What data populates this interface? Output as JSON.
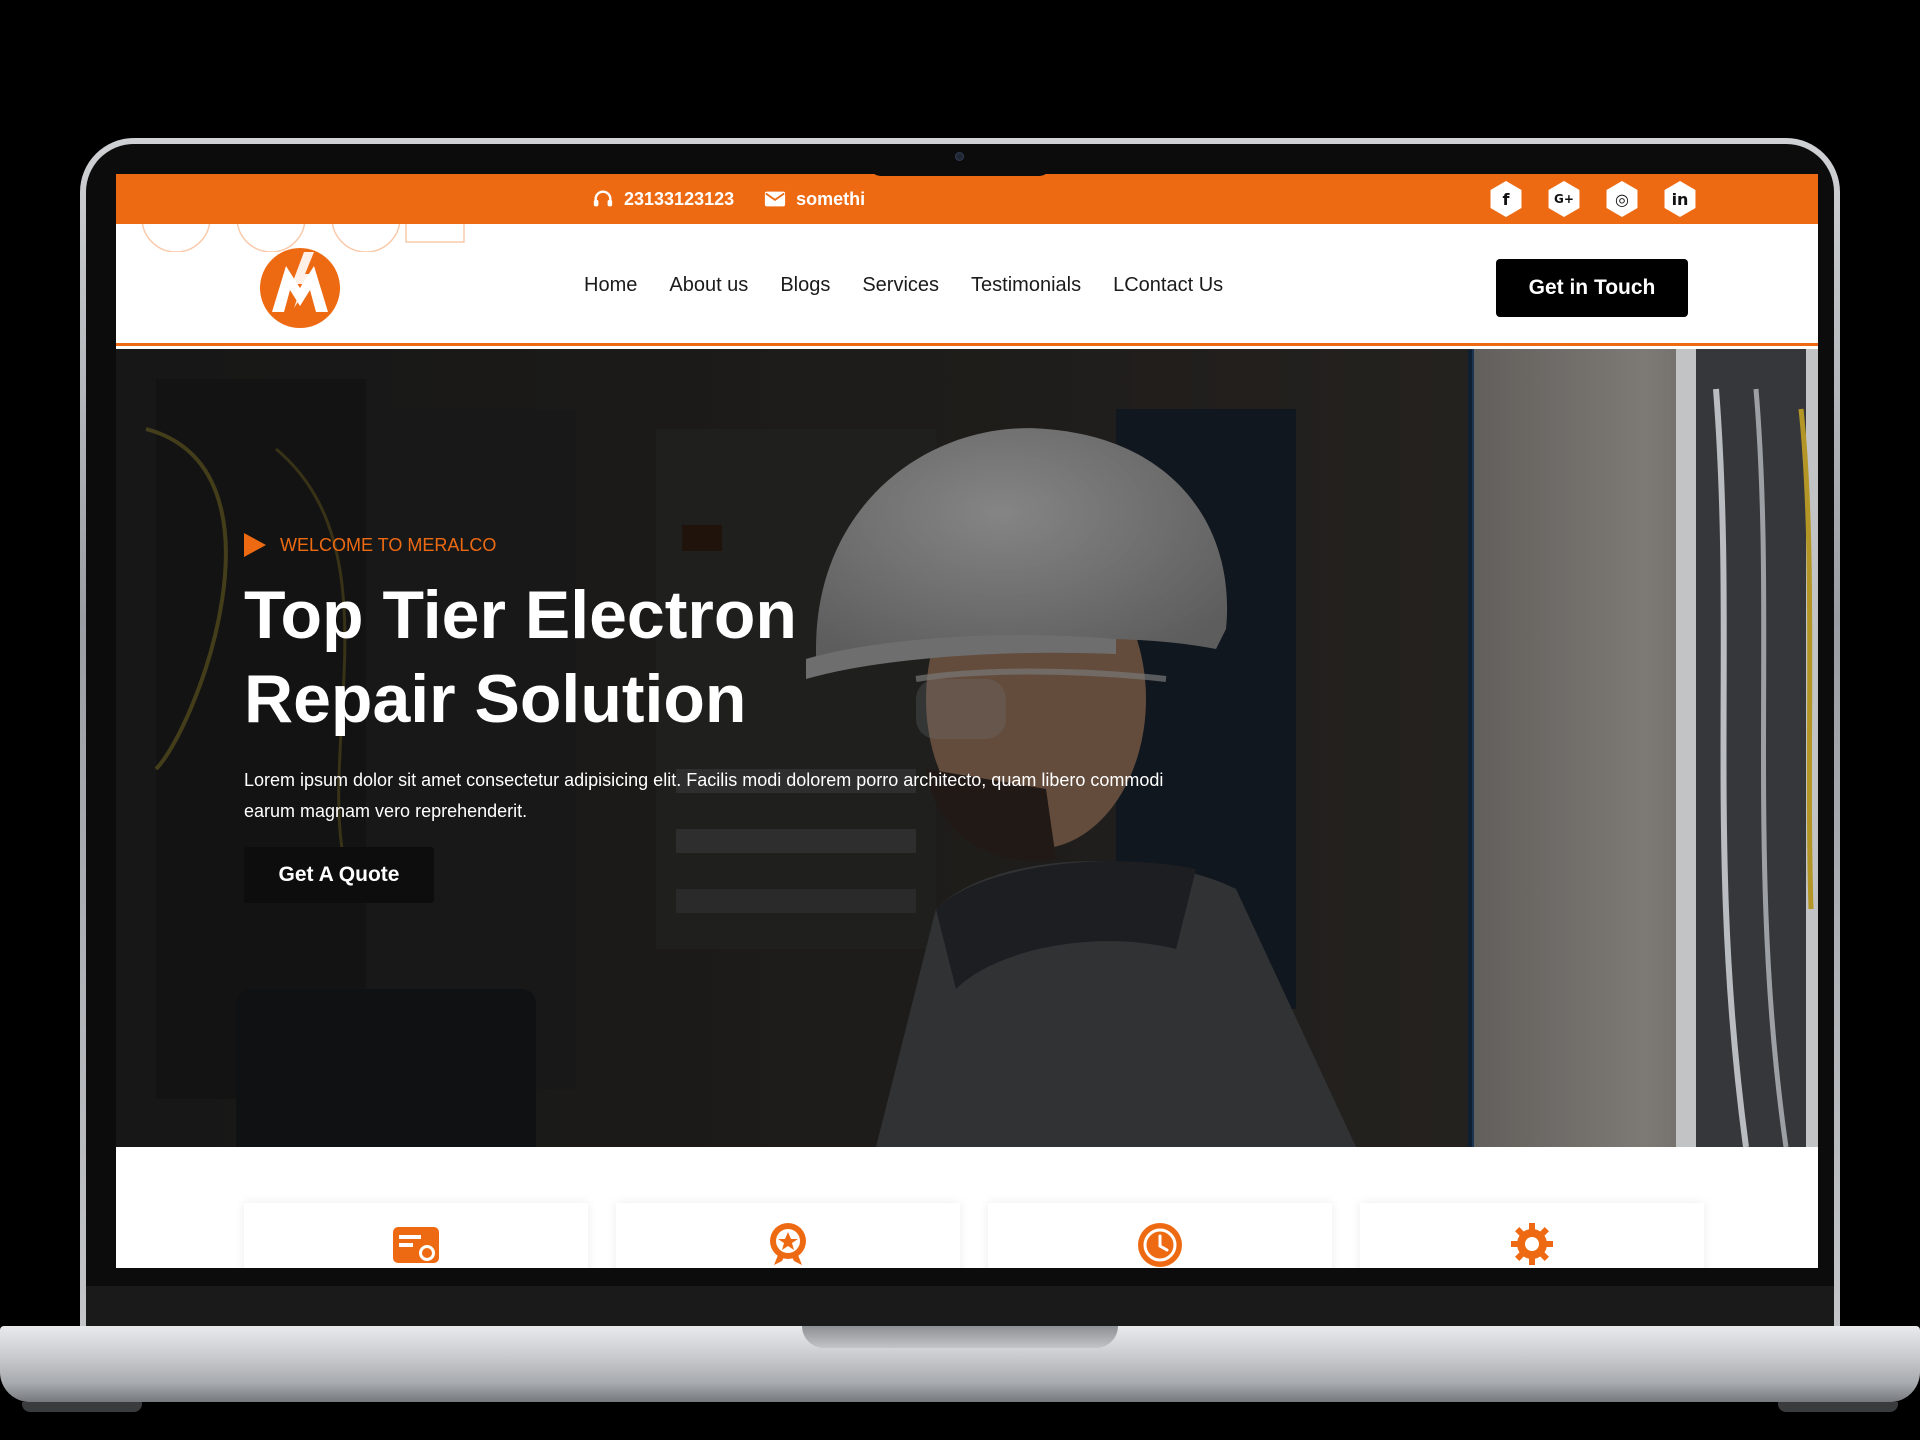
{
  "topbar": {
    "phone": "23133123123",
    "email": "somethi",
    "socials": [
      {
        "icon": "facebook-icon",
        "glyph": "f"
      },
      {
        "icon": "google-plus-icon",
        "glyph": "G+"
      },
      {
        "icon": "instagram-icon",
        "glyph": "◎"
      },
      {
        "icon": "linkedin-icon",
        "glyph": "in"
      }
    ]
  },
  "nav": {
    "items": [
      "Home",
      "About us",
      "Blogs",
      "Services",
      "Testimonials",
      "LContact Us"
    ],
    "cta": "Get in Touch"
  },
  "hero": {
    "eyebrow": "WELCOME TO MERALCO",
    "title_line1": "Top Tier Electron",
    "title_line2": "Repair Solution",
    "text": "Lorem ipsum dolor sit amet consectetur adipisicing elit. Facilis modi dolorem porro architecto, quam libero commodi earum magnam vero reprehenderit.",
    "cta": "Get A Quote"
  },
  "features": {
    "icons": [
      "invoice-icon",
      "award-badge-icon",
      "clock-icon",
      "gear-icon"
    ]
  },
  "colors": {
    "accent": "#ee6a12",
    "dark": "#000000",
    "white": "#ffffff"
  }
}
